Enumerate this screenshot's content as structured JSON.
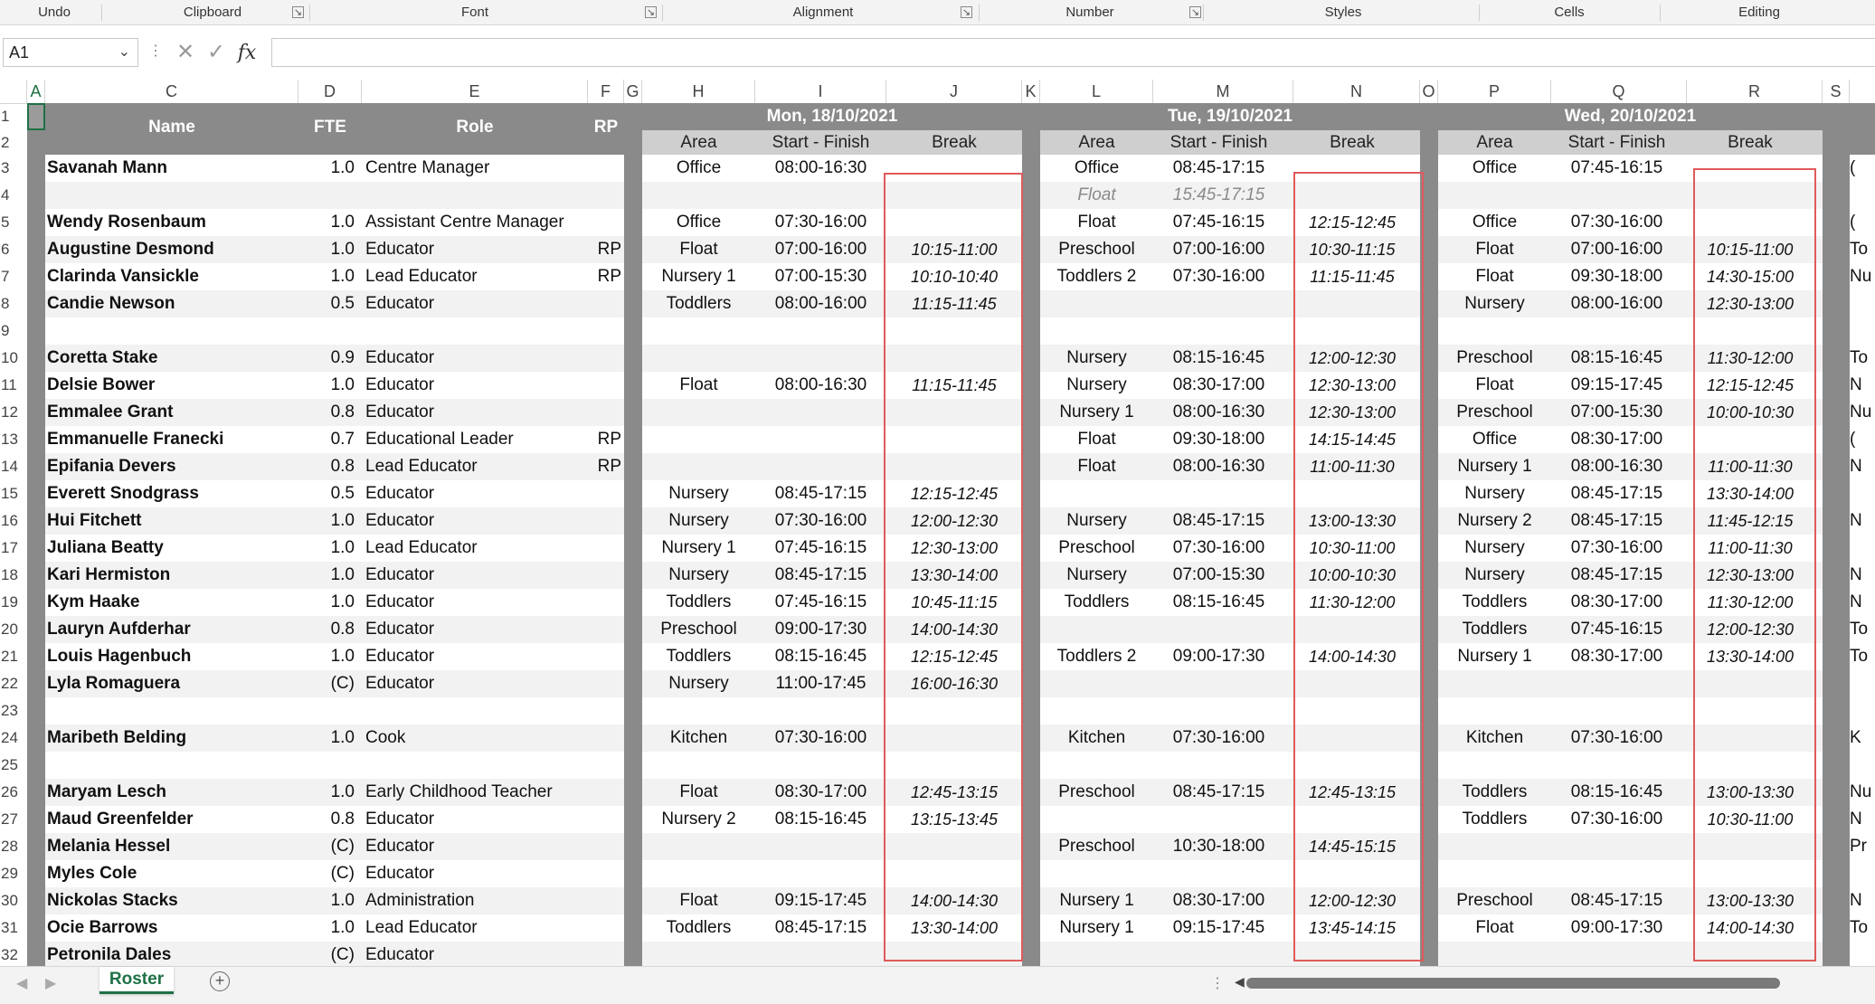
{
  "ribbon": {
    "groups": [
      "Undo",
      "Clipboard",
      "Font",
      "Alignment",
      "Number",
      "Styles",
      "Cells",
      "Editing"
    ]
  },
  "formula_bar": {
    "name_box": "A1",
    "fx_label": "fx",
    "value": ""
  },
  "columns": [
    "A",
    "C",
    "D",
    "E",
    "F",
    "G",
    "H",
    "I",
    "J",
    "K",
    "L",
    "M",
    "N",
    "O",
    "P",
    "Q",
    "R",
    "S"
  ],
  "headers": {
    "name": "Name",
    "fte": "FTE",
    "role": "Role",
    "rp": "RP",
    "days": [
      {
        "date": "Mon, 18/10/2021",
        "area": "Area",
        "time": "Start - Finish",
        "brk": "Break"
      },
      {
        "date": "Tue, 19/10/2021",
        "area": "Area",
        "time": "Start - Finish",
        "brk": "Break"
      },
      {
        "date": "Wed, 20/10/2021",
        "area": "Area",
        "time": "Start - Finish",
        "brk": "Break"
      }
    ]
  },
  "row_numbers": [
    "1",
    "2",
    "3",
    "4",
    "5",
    "6",
    "7",
    "8",
    "9",
    "10",
    "11",
    "12",
    "13",
    "14",
    "15",
    "16",
    "17",
    "18",
    "19",
    "20",
    "21",
    "22",
    "23",
    "24",
    "25",
    "26",
    "27",
    "28",
    "29",
    "30",
    "31",
    "32"
  ],
  "rows": [
    {
      "n": "Savanah Mann",
      "f": "1.0",
      "r": "Centre Manager",
      "rp": "",
      "d": [
        [
          "Office",
          "08:00-16:30",
          ""
        ],
        [
          "Office",
          "08:45-17:15",
          ""
        ],
        [
          "Office",
          "07:45-16:15",
          ""
        ]
      ],
      "s": "("
    },
    {
      "n": "",
      "f": "",
      "r": "",
      "rp": "",
      "d": [
        [
          "",
          "",
          ""
        ],
        [
          "Float",
          "15:45-17:15",
          ""
        ],
        [
          "",
          "",
          ""
        ]
      ],
      "s": "",
      "gray": true
    },
    {
      "n": "Wendy Rosenbaum",
      "f": "1.0",
      "r": "Assistant Centre Manager",
      "rp": "",
      "d": [
        [
          "Office",
          "07:30-16:00",
          ""
        ],
        [
          "Float",
          "07:45-16:15",
          "12:15-12:45"
        ],
        [
          "Office",
          "07:30-16:00",
          ""
        ]
      ],
      "s": "("
    },
    {
      "n": "Augustine Desmond",
      "f": "1.0",
      "r": "Educator",
      "rp": "RP",
      "d": [
        [
          "Float",
          "07:00-16:00",
          "10:15-11:00"
        ],
        [
          "Preschool",
          "07:00-16:00",
          "10:30-11:15"
        ],
        [
          "Float",
          "07:00-16:00",
          "10:15-11:00"
        ]
      ],
      "s": "To"
    },
    {
      "n": "Clarinda Vansickle",
      "f": "1.0",
      "r": "Lead Educator",
      "rp": "RP",
      "d": [
        [
          "Nursery 1",
          "07:00-15:30",
          "10:10-10:40"
        ],
        [
          "Toddlers 2",
          "07:30-16:00",
          "11:15-11:45"
        ],
        [
          "Float",
          "09:30-18:00",
          "14:30-15:00"
        ]
      ],
      "s": "Nu"
    },
    {
      "n": "Candie Newson",
      "f": "0.5",
      "r": "Educator",
      "rp": "",
      "d": [
        [
          "Toddlers",
          "08:00-16:00",
          "11:15-11:45"
        ],
        [
          "",
          "",
          ""
        ],
        [
          "Nursery",
          "08:00-16:00",
          "12:30-13:00"
        ]
      ],
      "s": ""
    },
    {
      "n": "",
      "f": "",
      "r": "",
      "rp": "",
      "d": [
        [
          "",
          "",
          ""
        ],
        [
          "",
          "",
          ""
        ],
        [
          "",
          "",
          ""
        ]
      ],
      "s": ""
    },
    {
      "n": "Coretta Stake",
      "f": "0.9",
      "r": "Educator",
      "rp": "",
      "d": [
        [
          "",
          "",
          ""
        ],
        [
          "Nursery",
          "08:15-16:45",
          "12:00-12:30"
        ],
        [
          "Preschool",
          "08:15-16:45",
          "11:30-12:00"
        ]
      ],
      "s": "To"
    },
    {
      "n": "Delsie Bower",
      "f": "1.0",
      "r": "Educator",
      "rp": "",
      "d": [
        [
          "Float",
          "08:00-16:30",
          "11:15-11:45"
        ],
        [
          "Nursery",
          "08:30-17:00",
          "12:30-13:00"
        ],
        [
          "Float",
          "09:15-17:45",
          "12:15-12:45"
        ]
      ],
      "s": "N"
    },
    {
      "n": "Emmalee Grant",
      "f": "0.8",
      "r": "Educator",
      "rp": "",
      "d": [
        [
          "",
          "",
          ""
        ],
        [
          "Nursery 1",
          "08:00-16:30",
          "12:30-13:00"
        ],
        [
          "Preschool",
          "07:00-15:30",
          "10:00-10:30"
        ]
      ],
      "s": "Nu"
    },
    {
      "n": "Emmanuelle Franecki",
      "f": "0.7",
      "r": "Educational Leader",
      "rp": "RP",
      "d": [
        [
          "",
          "",
          ""
        ],
        [
          "Float",
          "09:30-18:00",
          "14:15-14:45"
        ],
        [
          "Office",
          "08:30-17:00",
          ""
        ]
      ],
      "s": "("
    },
    {
      "n": "Epifania Devers",
      "f": "0.8",
      "r": "Lead Educator",
      "rp": "RP",
      "d": [
        [
          "",
          "",
          ""
        ],
        [
          "Float",
          "08:00-16:30",
          "11:00-11:30"
        ],
        [
          "Nursery 1",
          "08:00-16:30",
          "11:00-11:30"
        ]
      ],
      "s": "N"
    },
    {
      "n": "Everett Snodgrass",
      "f": "0.5",
      "r": "Educator",
      "rp": "",
      "d": [
        [
          "Nursery",
          "08:45-17:15",
          "12:15-12:45"
        ],
        [
          "",
          "",
          ""
        ],
        [
          "Nursery",
          "08:45-17:15",
          "13:30-14:00"
        ]
      ],
      "s": ""
    },
    {
      "n": "Hui Fitchett",
      "f": "1.0",
      "r": "Educator",
      "rp": "",
      "d": [
        [
          "Nursery",
          "07:30-16:00",
          "12:00-12:30"
        ],
        [
          "Nursery",
          "08:45-17:15",
          "13:00-13:30"
        ],
        [
          "Nursery 2",
          "08:45-17:15",
          "11:45-12:15"
        ]
      ],
      "s": "N"
    },
    {
      "n": "Juliana Beatty",
      "f": "1.0",
      "r": "Lead Educator",
      "rp": "",
      "d": [
        [
          "Nursery 1",
          "07:45-16:15",
          "12:30-13:00"
        ],
        [
          "Preschool",
          "07:30-16:00",
          "10:30-11:00"
        ],
        [
          "Nursery",
          "07:30-16:00",
          "11:00-11:30"
        ]
      ],
      "s": ""
    },
    {
      "n": "Kari Hermiston",
      "f": "1.0",
      "r": "Educator",
      "rp": "",
      "d": [
        [
          "Nursery",
          "08:45-17:15",
          "13:30-14:00"
        ],
        [
          "Nursery",
          "07:00-15:30",
          "10:00-10:30"
        ],
        [
          "Nursery",
          "08:45-17:15",
          "12:30-13:00"
        ]
      ],
      "s": "N"
    },
    {
      "n": "Kym Haake",
      "f": "1.0",
      "r": "Educator",
      "rp": "",
      "d": [
        [
          "Toddlers",
          "07:45-16:15",
          "10:45-11:15"
        ],
        [
          "Toddlers",
          "08:15-16:45",
          "11:30-12:00"
        ],
        [
          "Toddlers",
          "08:30-17:00",
          "11:30-12:00"
        ]
      ],
      "s": "N"
    },
    {
      "n": "Lauryn Aufderhar",
      "f": "0.8",
      "r": "Educator",
      "rp": "",
      "d": [
        [
          "Preschool",
          "09:00-17:30",
          "14:00-14:30"
        ],
        [
          "",
          "",
          ""
        ],
        [
          "Toddlers",
          "07:45-16:15",
          "12:00-12:30"
        ]
      ],
      "s": "To"
    },
    {
      "n": "Louis Hagenbuch",
      "f": "1.0",
      "r": "Educator",
      "rp": "",
      "d": [
        [
          "Toddlers",
          "08:15-16:45",
          "12:15-12:45"
        ],
        [
          "Toddlers 2",
          "09:00-17:30",
          "14:00-14:30"
        ],
        [
          "Nursery 1",
          "08:30-17:00",
          "13:30-14:00"
        ]
      ],
      "s": "To"
    },
    {
      "n": "Lyla Romaguera",
      "f": "(C)",
      "r": "Educator",
      "rp": "",
      "d": [
        [
          "Nursery",
          "11:00-17:45",
          "16:00-16:30"
        ],
        [
          "",
          "",
          ""
        ],
        [
          "",
          "",
          ""
        ]
      ],
      "s": ""
    },
    {
      "n": "",
      "f": "",
      "r": "",
      "rp": "",
      "d": [
        [
          "",
          "",
          ""
        ],
        [
          "",
          "",
          ""
        ],
        [
          "",
          "",
          ""
        ]
      ],
      "s": ""
    },
    {
      "n": "Maribeth Belding",
      "f": "1.0",
      "r": "Cook",
      "rp": "",
      "d": [
        [
          "Kitchen",
          "07:30-16:00",
          ""
        ],
        [
          "Kitchen",
          "07:30-16:00",
          ""
        ],
        [
          "Kitchen",
          "07:30-16:00",
          ""
        ]
      ],
      "s": "K"
    },
    {
      "n": "",
      "f": "",
      "r": "",
      "rp": "",
      "d": [
        [
          "",
          "",
          ""
        ],
        [
          "",
          "",
          ""
        ],
        [
          "",
          "",
          ""
        ]
      ],
      "s": ""
    },
    {
      "n": "Maryam Lesch",
      "f": "1.0",
      "r": "Early Childhood Teacher",
      "rp": "",
      "d": [
        [
          "Float",
          "08:30-17:00",
          "12:45-13:15"
        ],
        [
          "Preschool",
          "08:45-17:15",
          "12:45-13:15"
        ],
        [
          "Toddlers",
          "08:15-16:45",
          "13:00-13:30"
        ]
      ],
      "s": "Nu"
    },
    {
      "n": "Maud Greenfelder",
      "f": "0.8",
      "r": "Educator",
      "rp": "",
      "d": [
        [
          "Nursery 2",
          "08:15-16:45",
          "13:15-13:45"
        ],
        [
          "",
          "",
          ""
        ],
        [
          "Toddlers",
          "07:30-16:00",
          "10:30-11:00"
        ]
      ],
      "s": "N"
    },
    {
      "n": "Melania Hessel",
      "f": "(C)",
      "r": "Educator",
      "rp": "",
      "d": [
        [
          "",
          "",
          ""
        ],
        [
          "Preschool",
          "10:30-18:00",
          "14:45-15:15"
        ],
        [
          "",
          "",
          ""
        ]
      ],
      "s": "Pr"
    },
    {
      "n": "Myles Cole",
      "f": "(C)",
      "r": "Educator",
      "rp": "",
      "d": [
        [
          "",
          "",
          ""
        ],
        [
          "",
          "",
          ""
        ],
        [
          "",
          "",
          ""
        ]
      ],
      "s": ""
    },
    {
      "n": "Nickolas Stacks",
      "f": "1.0",
      "r": "Administration",
      "rp": "",
      "d": [
        [
          "Float",
          "09:15-17:45",
          "14:00-14:30"
        ],
        [
          "Nursery 1",
          "08:30-17:00",
          "12:00-12:30"
        ],
        [
          "Preschool",
          "08:45-17:15",
          "13:00-13:30"
        ]
      ],
      "s": "N"
    },
    {
      "n": "Ocie Barrows",
      "f": "1.0",
      "r": "Lead Educator",
      "rp": "",
      "d": [
        [
          "Toddlers",
          "08:45-17:15",
          "13:30-14:00"
        ],
        [
          "Nursery 1",
          "09:15-17:45",
          "13:45-14:15"
        ],
        [
          "Float",
          "09:00-17:30",
          "14:00-14:30"
        ]
      ],
      "s": "To"
    },
    {
      "n": "Petronila Dales",
      "f": "(C)",
      "r": "Educator",
      "rp": "",
      "d": [
        [
          "",
          "",
          ""
        ],
        [
          "",
          "",
          ""
        ],
        [
          "",
          "",
          ""
        ]
      ],
      "s": ""
    }
  ],
  "sheet_tab": "Roster",
  "colors": {
    "header_gray": "#8a8a8a",
    "sub_gray": "#cfcfcf",
    "band": "#f2f2f2",
    "accent": "#1e7145",
    "red": "#e05a5a"
  }
}
